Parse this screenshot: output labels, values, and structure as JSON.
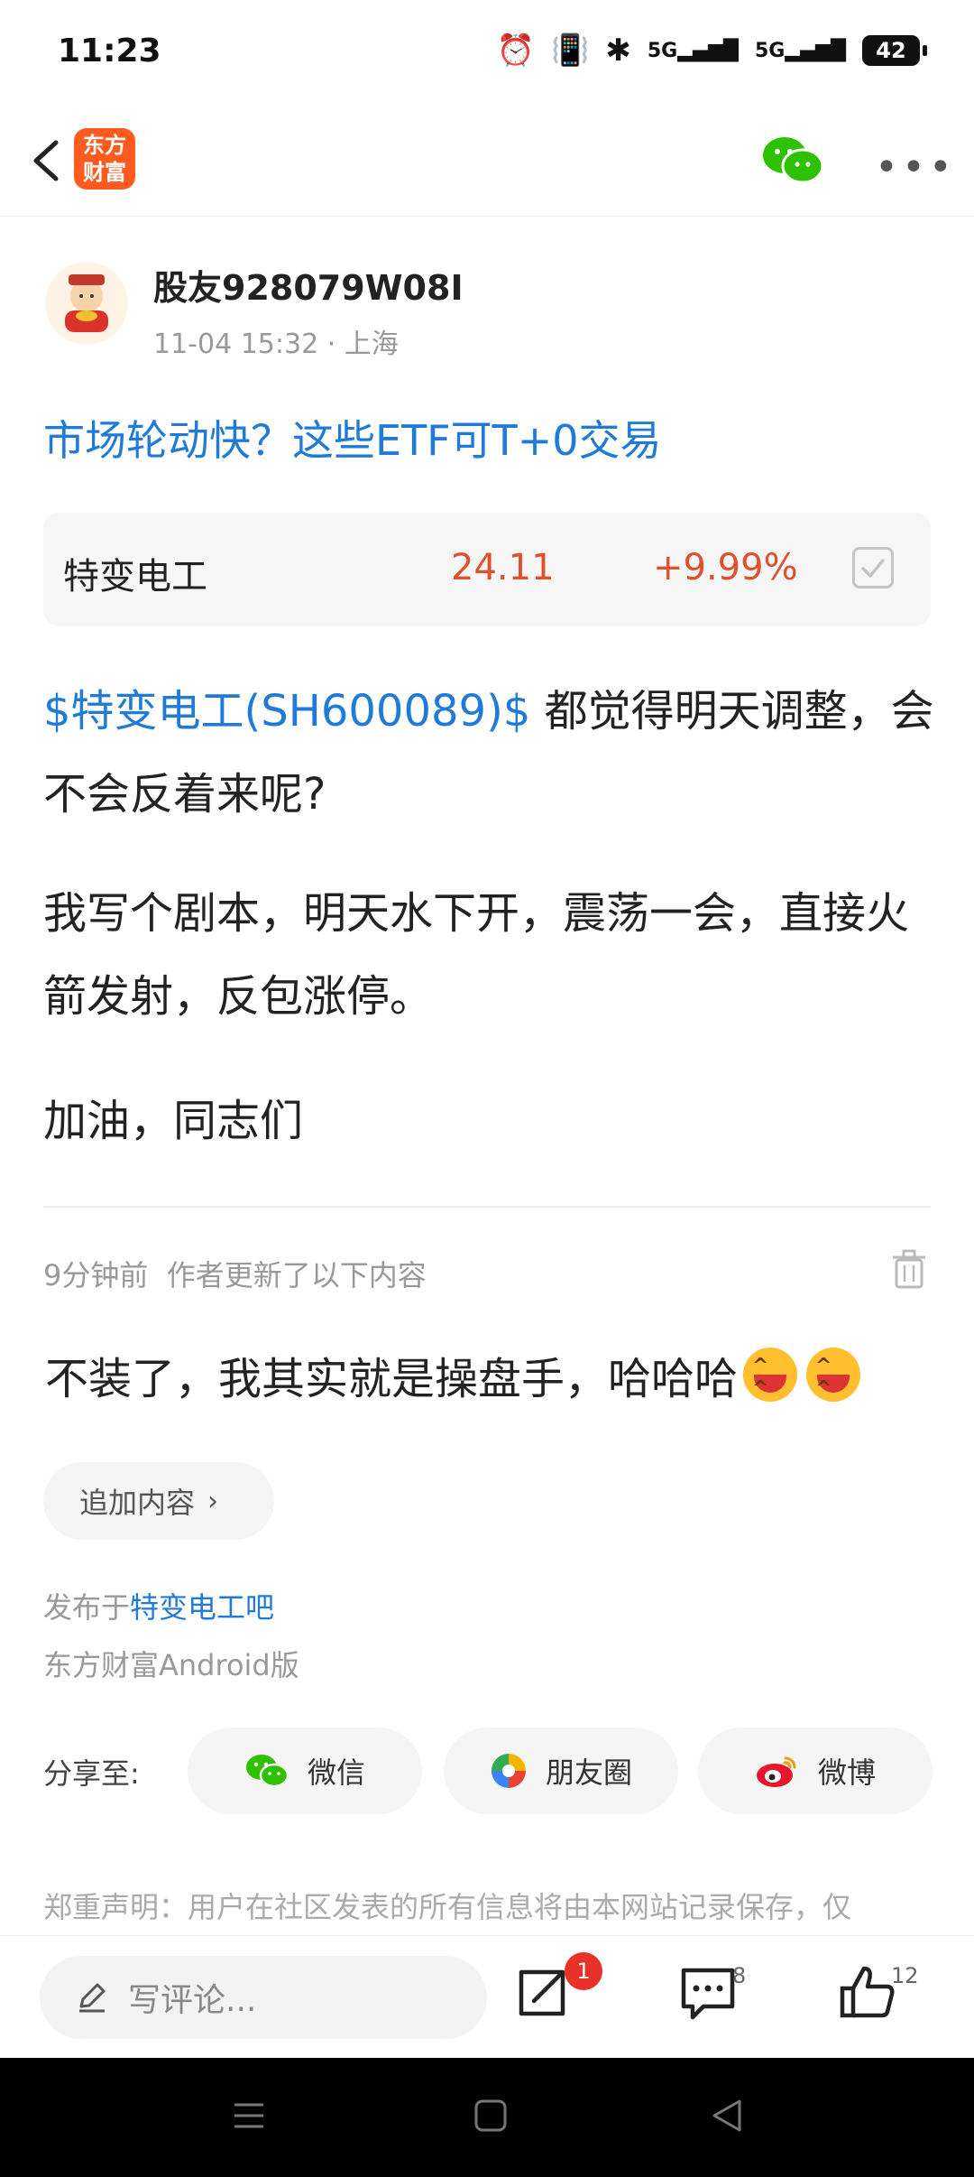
{
  "status_bar": {
    "time": "11:23",
    "signal_1": "5G",
    "signal_2": "5G",
    "battery": "42"
  },
  "nav": {
    "logo_line1": "东方",
    "logo_line2": "财富",
    "logo_color": "#ff5a1f"
  },
  "post": {
    "author": "股友928079W08I",
    "time": "11-04 15:32",
    "location": "· 上海",
    "title": "市场轮动快？这些ETF可T+0交易",
    "stock": {
      "name": "特变电工",
      "price": "24.11",
      "change": "+9.99%",
      "color": "#e0502b"
    },
    "stock_tag": "$特变电工(SH600089)$",
    "para1_rest": " 都觉得明天调整，会不会反着来呢?",
    "para2": "我写个剧本，明天水下开，震荡一会，直接火箭发射，反包涨停。",
    "para3": "加油，同志们"
  },
  "update": {
    "time_ago": "9分钟前",
    "label": "作者更新了以下内容",
    "text": "不装了，我其实就是操盘手，哈哈哈"
  },
  "add_content": {
    "label": "追加内容"
  },
  "source": {
    "published_prefix": "发布于",
    "bar_name": "特变电工吧",
    "client": "东方财富Android版"
  },
  "share": {
    "label": "分享至:",
    "wechat": "微信",
    "moments": "朋友圈",
    "weibo": "微博"
  },
  "disclaimer": "郑重声明：用户在社区发表的所有信息将由本网站记录保存，仅",
  "bottom": {
    "comment_placeholder": "写评论...",
    "share_badge": "1",
    "comment_count": "8",
    "like_count": "12"
  },
  "colors": {
    "link_blue": "#1f7ad8",
    "accent_red": "#e0502b"
  }
}
